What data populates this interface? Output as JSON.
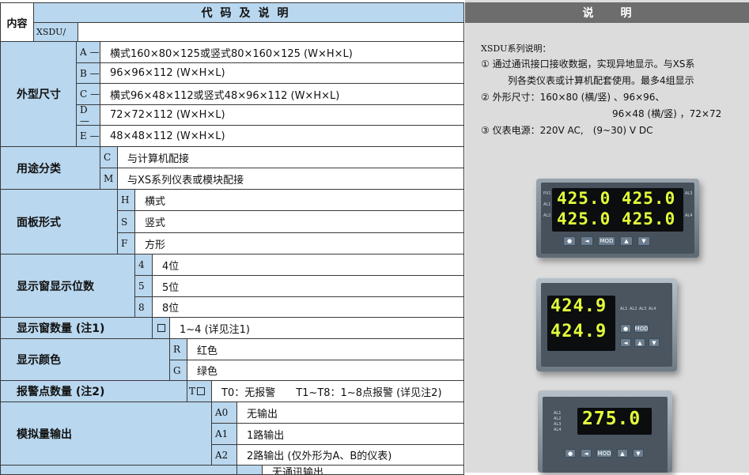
{
  "table": {
    "corner_label": "内容",
    "header_title": "代码及说明",
    "model_prefix": "XSDU/",
    "categories": [
      {
        "label": "外型尺寸",
        "options": [
          {
            "code": "A —",
            "desc": "横式160×80×125或竖式80×160×125 (W×H×L)"
          },
          {
            "code": "B —",
            "desc": "96×96×112 (W×H×L)"
          },
          {
            "code": "C —",
            "desc": "横式96×48×112或竖式48×96×112 (W×H×L)"
          },
          {
            "code": "D —",
            "desc": "72×72×112 (W×H×L)"
          },
          {
            "code": "E —",
            "desc": "48×48×112 (W×H×L)"
          }
        ]
      },
      {
        "label": "用途分类",
        "options": [
          {
            "code": "C",
            "desc": "与计算机配接"
          },
          {
            "code": "M",
            "desc": "与XS系列仪表或模块配接"
          }
        ]
      },
      {
        "label": "面板形式",
        "options": [
          {
            "code": "H",
            "desc": "横式"
          },
          {
            "code": "S",
            "desc": "竖式"
          },
          {
            "code": "F",
            "desc": "方形"
          }
        ]
      },
      {
        "label": "显示窗显示位数",
        "options": [
          {
            "code": "4",
            "desc": "4位"
          },
          {
            "code": "5",
            "desc": "5位"
          },
          {
            "code": "8",
            "desc": "8位"
          }
        ]
      },
      {
        "label": "显示窗数量 (注1)",
        "options": [
          {
            "code": "",
            "desc": "1~4 (详见注1)"
          }
        ]
      },
      {
        "label": "显示颜色",
        "options": [
          {
            "code": "R",
            "desc": "红色"
          },
          {
            "code": "G",
            "desc": "绿色"
          }
        ]
      },
      {
        "label": "报警点数量 (注2)",
        "options": [
          {
            "code": "T",
            "desc": "T0：无报警　　T1~T8：1~8点报警 (详见注2)"
          }
        ]
      },
      {
        "label": "模拟量输出",
        "options": [
          {
            "code": "A0",
            "desc": "无输出"
          },
          {
            "code": "A1",
            "desc": "1路输出"
          },
          {
            "code": "A2",
            "desc": "2路输出 (仅外形为A、B的仪表)"
          }
        ]
      }
    ],
    "cut_off_row_text": "无通讯输出"
  },
  "notes": {
    "header_title": "说明",
    "series_title": "XSDU系列说明：",
    "item1_line1": "① 通过通讯接口接收数据，实现异地显示。与XS系",
    "item1_line2": "列各类仪表或计算机配套使用。最多4组显示",
    "item2_line1": "② 外形尺寸：160×80 (横/竖) 、96×96、",
    "item2_line2": "96×48 (横/竖) ，72×72",
    "item3": "③ 仪表电源：220V AC,　(9~30) V DC"
  },
  "devices": [
    {
      "readings": [
        "425.0",
        "425.0",
        "425.0",
        "425.0"
      ],
      "side_labels": [
        "PV1",
        "AL1",
        "AL2",
        "AL3",
        "AL4"
      ],
      "buttons": [
        "●",
        "◄",
        "MOD",
        "▲",
        "▼"
      ]
    },
    {
      "readings": [
        "424.9",
        "424.9"
      ],
      "side_labels": [
        "AL1",
        "AL2",
        "AL3",
        "AL4"
      ],
      "buttons": [
        "●",
        "MOD",
        "◄",
        "▲",
        "▼"
      ]
    },
    {
      "readings": [
        "275.0"
      ],
      "side_labels": [
        "AL1",
        "AL2",
        "AL3",
        "AL4"
      ],
      "buttons": [
        "●",
        "◄",
        "MOD",
        "▲",
        "▼"
      ]
    }
  ],
  "colors": {
    "header_blue": "#b9d7ee",
    "notes_panel": "#dcdcdc",
    "notes_header": "#6d6d6d",
    "segment_display": "#e3ff3a"
  }
}
